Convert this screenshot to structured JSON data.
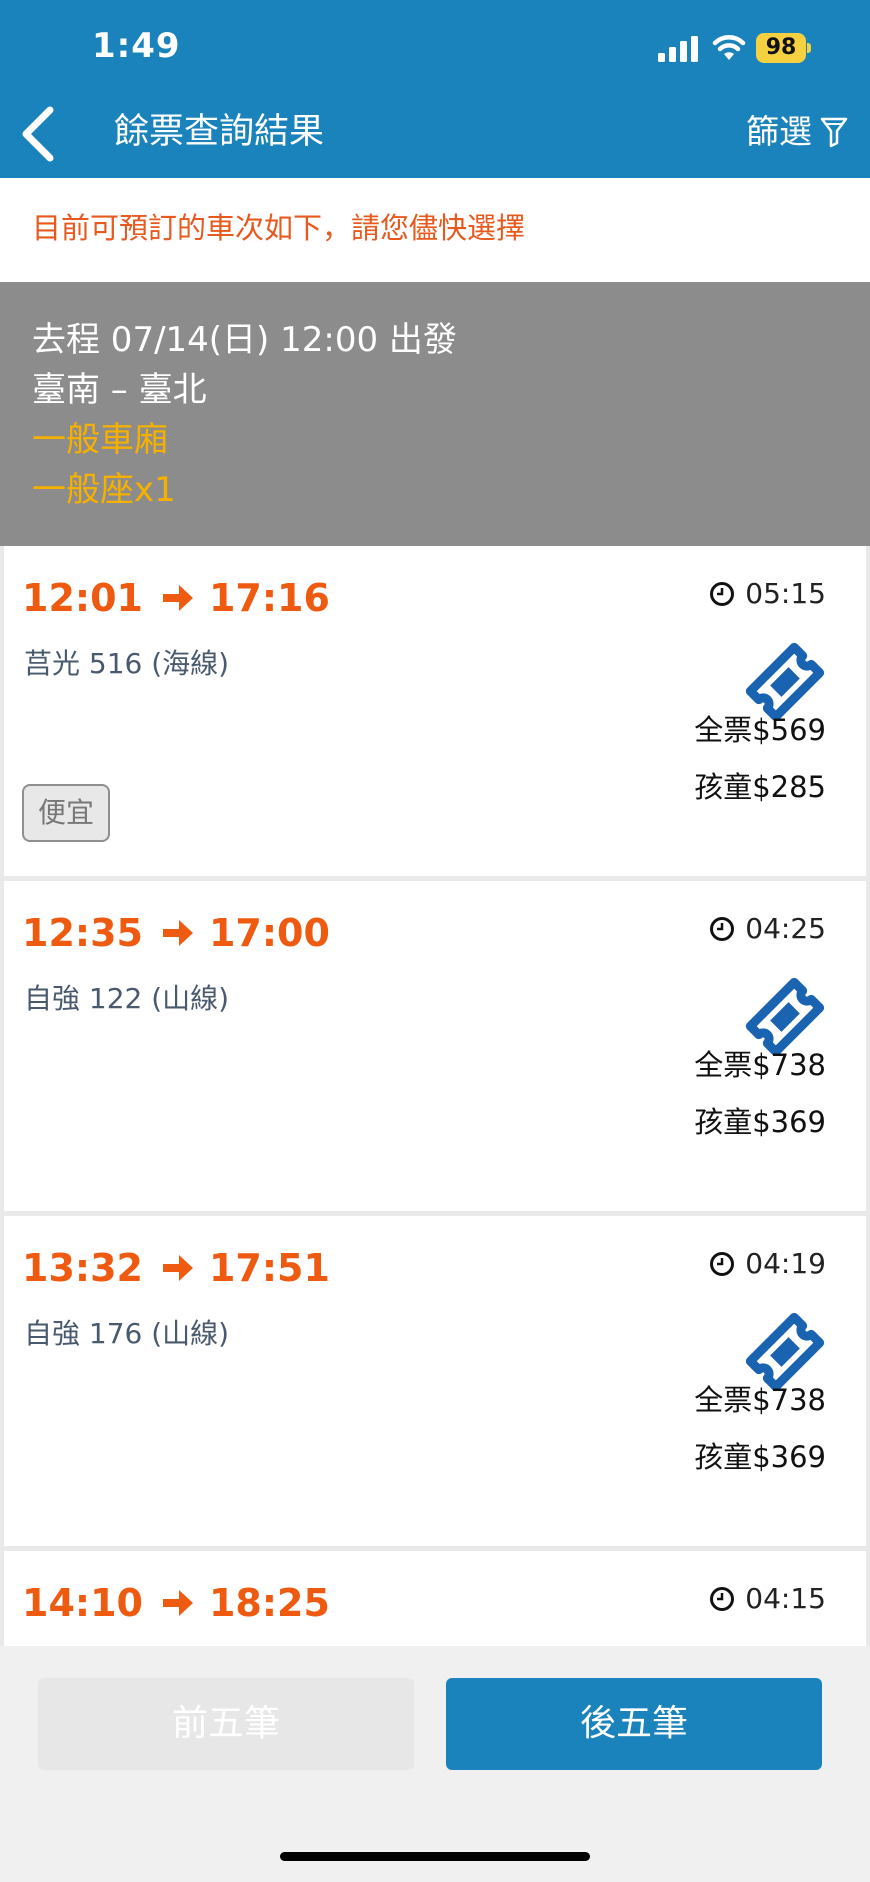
{
  "status_bar": {
    "time": "1:49",
    "battery": "98"
  },
  "header": {
    "title": "餘票查詢結果",
    "filter_label": "篩選"
  },
  "notice": "目前可預訂的車次如下，請您儘快選擇",
  "trip_summary": {
    "line1": "去程 07/14(日) 12:00 出發",
    "line2": "臺南 – 臺北",
    "car_type": "一般車廂",
    "seat": "一般座x1"
  },
  "trains": [
    {
      "depart": "12:01",
      "arrive": "17:16",
      "train": "莒光 516 (海線)",
      "duration": "05:15",
      "adult": "全票$569",
      "child": "孩童$285",
      "tag": "便宜"
    },
    {
      "depart": "12:35",
      "arrive": "17:00",
      "train": "自強 122 (山線)",
      "duration": "04:25",
      "adult": "全票$738",
      "child": "孩童$369"
    },
    {
      "depart": "13:32",
      "arrive": "17:51",
      "train": "自強 176 (山線)",
      "duration": "04:19",
      "adult": "全票$738",
      "child": "孩童$369"
    },
    {
      "depart": "14:10",
      "arrive": "18:25",
      "duration": "04:15"
    }
  ],
  "pagination": {
    "prev": "前五筆",
    "next": "後五筆"
  },
  "colors": {
    "primary": "#1b83bc",
    "accent": "#ee5a10",
    "summary_bg": "#8c8c8c",
    "highlight": "#f5b000"
  }
}
